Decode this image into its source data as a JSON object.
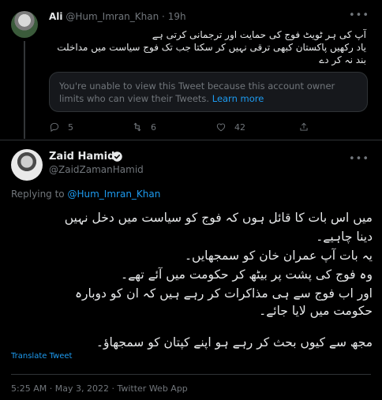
{
  "reply_tweet": {
    "author_name": "Ali",
    "author_handle": "@Hum_Imran_Khan",
    "separator": "·",
    "time_ago": "19h",
    "lines": [
      "آپ کی ہر ٹویٹ فوج کی حمایت اور ترجمانی کرتی ہے",
      "یاد رکھیں پاکستان کبھی ترقی نہیں کر سکتا جب تک فوج سیاست میں مداخلت",
      "بند نہ کر دے"
    ],
    "notice_text": "You're unable to view this Tweet because this account owner limits who can view their Tweets.",
    "notice_link": "Learn more",
    "reply_count": "5",
    "retweet_count": "6",
    "like_count": "42"
  },
  "main_tweet": {
    "author_name": "Zaid Hamid",
    "author_handle": "@ZaidZamanHamid",
    "replying_prefix": "Replying to",
    "replying_handle": "@Hum_Imran_Khan",
    "lines": [
      "میں اس بات کا قائل ہوں کہ فوج کو سیاست میں دخل نہیں",
      "دینا چاہیے۔",
      "یہ بات آپ عمران خان کو سمجھایں۔",
      "وہ فوج کی پشت پر بیٹھ کر حکومت میں آئے تھے۔",
      "اور اب فوج سے ہی مذاکرات کر رہے ہیں کہ ان کو دوبارہ",
      "حکومت میں لایا جائے۔",
      "",
      "مجھ سے کیوں بحث کر رہے ہو اپنے کپتان کو سمجھاؤ۔"
    ],
    "translate_label": "Translate Tweet",
    "time": "5:25 AM",
    "date": "May 3, 2022",
    "source": "Twitter Web App",
    "meta_separator": "·"
  },
  "icons": {
    "more": "more-icon",
    "reply": "reply-icon",
    "retweet": "retweet-icon",
    "like": "heart-icon",
    "share": "share-icon",
    "verified": "verified-badge-icon"
  },
  "colors": {
    "background": "#000000",
    "text": "#e7e9ea",
    "muted": "#71767b",
    "link": "#1d9bf0",
    "border": "#2f3336"
  }
}
